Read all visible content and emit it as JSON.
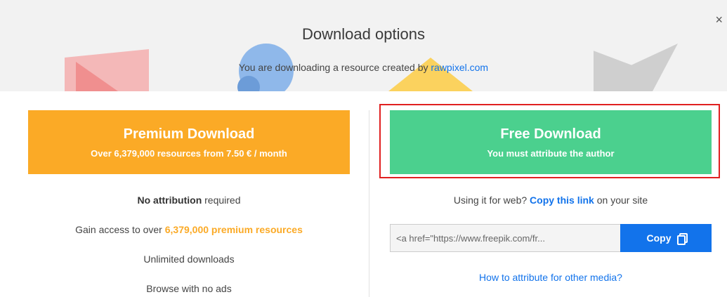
{
  "header": {
    "title": "Download options",
    "subtitle_prefix": "You are downloading a resource created by",
    "author_link": "rawpixel.com",
    "close_label": "×"
  },
  "premium": {
    "button_title": "Premium Download",
    "button_subtitle": "Over 6,379,000 resources from 7.50 € / month",
    "features": {
      "f1_bold": "No attribution",
      "f1_rest": "required",
      "f2_prefix": "Gain access to over",
      "f2_accent": "6,379,000 premium resources",
      "f3_bold": "Unlimited",
      "f3_rest": "downloads",
      "f4": "Browse with no ads"
    }
  },
  "free": {
    "button_title": "Free Download",
    "button_subtitle": "You must attribute the author",
    "web_prefix": "Using it for web?",
    "web_link": "Copy this link",
    "web_suffix": "on your site",
    "attribution_value": "<a href=\"https://www.freepik.com/fr...",
    "copy_label": "Copy",
    "other_media_link": "How to attribute for other media?"
  },
  "colors": {
    "premium": "#fbaa26",
    "free": "#4bd08e",
    "link": "#1273eb",
    "highlight": "#e02020"
  }
}
